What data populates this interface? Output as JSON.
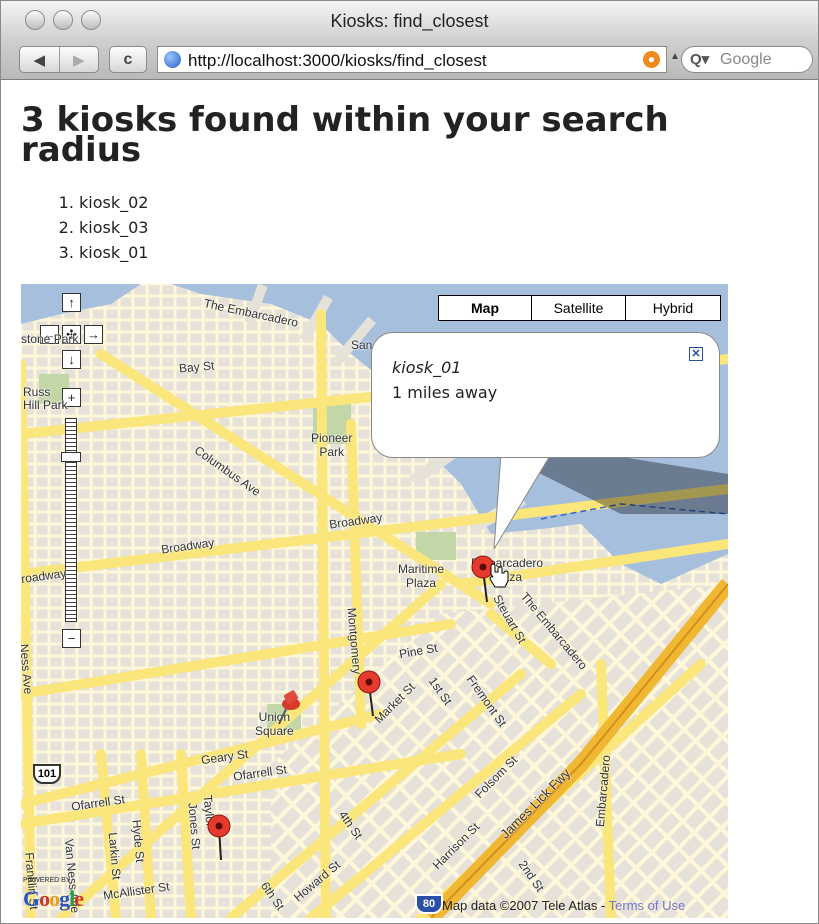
{
  "window": {
    "title": "Kiosks: find_closest"
  },
  "toolbar": {
    "back_icon": "◀",
    "forward_icon": "▶",
    "reload_icon": "c",
    "url": "http://localhost:3000/kiosks/find_closest",
    "search_placeholder": "Google",
    "search_icon": "Q▾"
  },
  "page": {
    "heading": "3 kiosks found within your search radius",
    "kiosks": [
      "kiosk_02",
      "kiosk_03",
      "kiosk_01"
    ]
  },
  "map": {
    "map_types": [
      "Map",
      "Satellite",
      "Hybrid"
    ],
    "selected_type": "Map",
    "controls": {
      "up": "↑",
      "down": "↓",
      "left": "←",
      "right": "→",
      "center": "✣",
      "zoom_in": "+",
      "zoom_out": "−"
    },
    "info_window": {
      "title": "kiosk_01",
      "distance": "1 miles away",
      "close": "✕"
    },
    "labels": {
      "embarcadero_top": "The Embarcadero",
      "bay_st": "Bay St",
      "russian_hill": "Russ\nHill Park",
      "pioneer_park": "Pioneer\nPark",
      "columbus": "Columbus Ave",
      "broadway_right": "Broadway",
      "broadway_mid": "Broadway",
      "broadway_left": "roadway",
      "maritime": "Maritime\nPlaza",
      "emb_center": "Embarcadero\nPlaza",
      "montgomery": "Montgomery",
      "steuart": "Steuart St",
      "the_embarcadero": "The Embarcadero",
      "pine_st": "Pine St",
      "market_st": "Market St",
      "first_st": "1st St",
      "fremont": "Fremont St",
      "union_sq": "Union\nSquare",
      "geary": "Geary St",
      "ofarrell_right": "Ofarrell St",
      "ofarrell_left": "Ofarrell St",
      "folsom": "Folsom St",
      "james_lick": "James Lick Fwy",
      "embarcadero_side": "Embarcadero",
      "harrison": "Harrison St",
      "fourth_st": "4th St",
      "howard": "Howard St",
      "sixth": "6th St",
      "second": "2nd St",
      "jones": "Jones St",
      "taylor": "Taylor",
      "hyde": "Hyde St",
      "larkin": "Larkin St",
      "vanness_left": "Van Ness Ave",
      "mcallister": "McAllister St",
      "franklin": "Franklin St",
      "sansome": "San",
      "ness_ave": "Ness Ave",
      "stone_park": "stone Park"
    },
    "hwy_101": "101",
    "hwy_80": "80",
    "copyright": "Map data ©2007 Tele Atlas - ",
    "terms": "Terms of Use",
    "powered_by": "POWERED BY",
    "google_logo": "Google",
    "colors": {
      "water": "#a5bfdd",
      "road": "#fbe67b",
      "park": "#c2d6a8",
      "land": "#f2efe6",
      "block": "#e6e2d9",
      "freeway": "#f0b733",
      "marker": "#e53a2c"
    }
  }
}
